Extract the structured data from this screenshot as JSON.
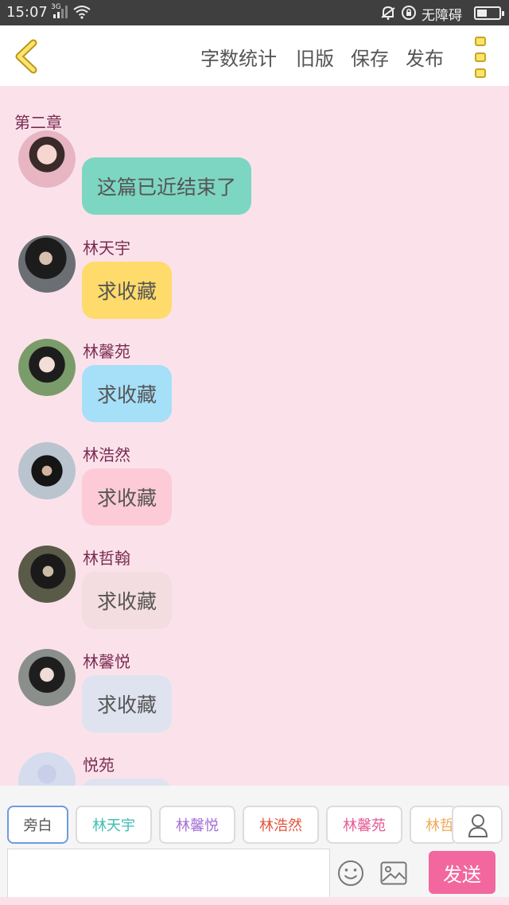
{
  "status_bar": {
    "time": "15:07",
    "network": "3G",
    "accessibility": "无障碍"
  },
  "top_bar": {
    "word_count": "字数统计",
    "old_version": "旧版",
    "save": "保存",
    "publish": "发布"
  },
  "chapter_title": "第二章",
  "messages": [
    {
      "name": "",
      "text": "这篇已近结束了",
      "bubble_color": "#7dd6c2"
    },
    {
      "name": "林天宇",
      "text": "求收藏",
      "bubble_color": "#fedb6a"
    },
    {
      "name": "林馨苑",
      "text": "求收藏",
      "bubble_color": "#a6dff8"
    },
    {
      "name": "林浩然",
      "text": "求收藏",
      "bubble_color": "#fdcbd8"
    },
    {
      "name": "林哲翰",
      "text": "求收藏",
      "bubble_color": "#f4dde0"
    },
    {
      "name": "林馨悦",
      "text": "求收藏",
      "bubble_color": "#dfe3ef"
    },
    {
      "name": "悦苑",
      "text": "",
      "bubble_color": "#dfe3ef"
    }
  ],
  "characters": [
    {
      "label": "旁白",
      "color": "#555555",
      "selected": true
    },
    {
      "label": "林天宇",
      "color": "#3dbdb0"
    },
    {
      "label": "林馨悦",
      "color": "#a46fd6"
    },
    {
      "label": "林浩然",
      "color": "#e0553d"
    },
    {
      "label": "林馨苑",
      "color": "#e45b95"
    },
    {
      "label": "林哲",
      "color": "#f0a95b"
    }
  ],
  "composer": {
    "send_label": "发送",
    "input_value": ""
  },
  "colors": {
    "accent": "#f2679d",
    "background": "#fbe2ea",
    "name_color": "#7a2c52"
  }
}
